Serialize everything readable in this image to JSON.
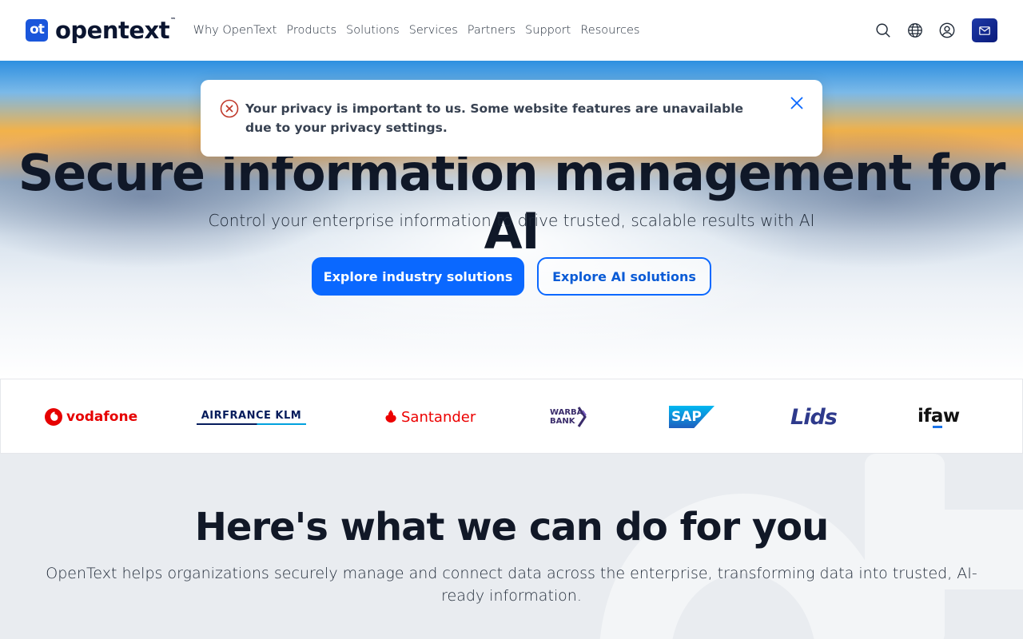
{
  "header": {
    "logo_text": "opentext",
    "logo_mark": "ot",
    "logo_tm": "™",
    "nav": [
      {
        "label": "Why OpenText"
      },
      {
        "label": "Products"
      },
      {
        "label": "Solutions"
      },
      {
        "label": "Services"
      },
      {
        "label": "Partners"
      },
      {
        "label": "Support"
      },
      {
        "label": "Resources"
      }
    ],
    "actions": [
      "search-icon",
      "globe-icon",
      "user-icon",
      "mail-icon"
    ]
  },
  "toast": {
    "message": "Your privacy is important to us. Some website features are unavailable due to your privacy settings.",
    "icon": "error-circle-icon",
    "close_icon": "close-icon"
  },
  "hero": {
    "title": "Secure information management for AI",
    "subtitle": "Control your enterprise information to drive trusted, scalable results with AI",
    "primary_cta": "Explore industry solutions",
    "secondary_cta": "Explore AI solutions"
  },
  "customers": [
    {
      "name": "vodafone"
    },
    {
      "name": "AIRFRANCE KLM"
    },
    {
      "name": "Santander"
    },
    {
      "name": "WARBA BANK"
    },
    {
      "name": "SAP"
    },
    {
      "name": "Lids"
    },
    {
      "name": "ifaw"
    }
  ],
  "section": {
    "title": "Here's what we can do for you",
    "description": "OpenText helps organizations securely manage and connect data across the enterprise, transforming data into trusted, AI-ready information."
  },
  "colors": {
    "brand_blue": "#0a68ff",
    "navy": "#0b1530",
    "error_red": "#c0392b"
  }
}
